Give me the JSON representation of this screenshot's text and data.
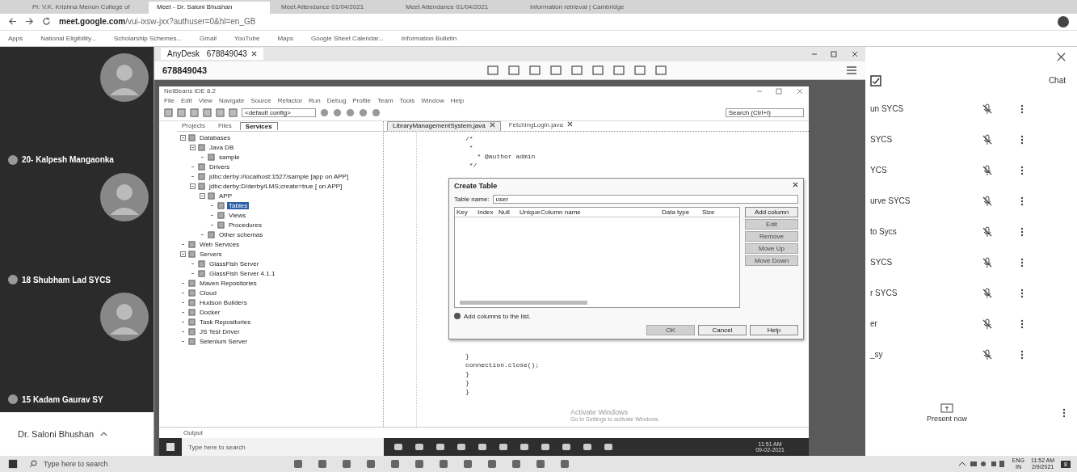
{
  "browser": {
    "tabs": [
      {
        "label": "Pr. V.K. Krishna Menon College of",
        "selected": false
      },
      {
        "label": "Meet - Dr. Saloni Bhushan",
        "selected": true
      },
      {
        "label": "Meet Attendance 01/04/2021",
        "selected": false
      },
      {
        "label": "Meet Attendance 01/04/2021",
        "selected": false
      },
      {
        "label": "Information retrieval | Cambridge",
        "selected": false
      }
    ],
    "address_host": "meet.google.com",
    "address_path": "/vui-ixsw-jxx?authuser=0&hl=en_GB",
    "bookmarks": [
      "Apps",
      "National Eligibility...",
      "Scholarship Schemes...",
      "Gmail",
      "YouTube",
      "Maps",
      "Google Sheet Calendar...",
      "Information Bulletin"
    ]
  },
  "meet": {
    "tiles": [
      {
        "name": "20- Kalpesh Mangaonka"
      },
      {
        "name": "18 Shubham Lad SYCS"
      },
      {
        "name": "15 Kadam Gaurav SY"
      }
    ],
    "presenter": "Dr. Saloni Bhushan",
    "chat": "Chat",
    "people": [
      {
        "name": "un SYCS",
        "muted": true
      },
      {
        "name": "SYCS",
        "muted": true
      },
      {
        "name": "YCS",
        "muted": true
      },
      {
        "name": "urve SYCS",
        "muted": true
      },
      {
        "name": "to Sycs",
        "muted": true
      },
      {
        "name": "SYCS",
        "muted": true
      },
      {
        "name": "r SYCS",
        "muted": true
      },
      {
        "name": "er",
        "muted": true
      },
      {
        "name": "_sy",
        "muted": true
      }
    ],
    "present": "Present now"
  },
  "anydesk": {
    "tab": "AnyDesk",
    "tab_id": "678849043",
    "address": "678849043"
  },
  "netbeans": {
    "title": "NetBeans IDE 8.2",
    "menu": [
      "File",
      "Edit",
      "View",
      "Navigate",
      "Source",
      "Refactor",
      "Run",
      "Debug",
      "Profile",
      "Team",
      "Tools",
      "Window",
      "Help"
    ],
    "config": "<default config>",
    "search": "Search (Ctrl+I)",
    "panel_tabs": [
      {
        "label": "Projects",
        "selected": false
      },
      {
        "label": "Files",
        "selected": false
      },
      {
        "label": "Services",
        "selected": true
      }
    ],
    "tree": [
      {
        "label": "Databases",
        "selected": false,
        "children": [
          {
            "label": "Java DB",
            "selected": false,
            "children": [
              {
                "label": "sample",
                "selected": false
              }
            ]
          },
          {
            "label": "Drivers",
            "selected": false
          },
          {
            "label": "jdbc:derby://localhost:1527/sample [app on APP]",
            "selected": false
          },
          {
            "label": "jdbc:derby:D/derby/LMS;create=true [ on APP]",
            "selected": false,
            "children": [
              {
                "label": "APP",
                "selected": false,
                "children": [
                  {
                    "label": "Tables",
                    "selected": true
                  },
                  {
                    "label": "Views",
                    "selected": false
                  },
                  {
                    "label": "Procedures",
                    "selected": false
                  }
                ]
              },
              {
                "label": "Other schemas",
                "selected": false
              }
            ]
          }
        ]
      },
      {
        "label": "Web Services",
        "selected": false
      },
      {
        "label": "Servers",
        "selected": false,
        "children": [
          {
            "label": "GlassFish Server",
            "selected": false
          },
          {
            "label": "GlassFish Server 4.1.1",
            "selected": false
          }
        ]
      },
      {
        "label": "Maven Repositories",
        "selected": false
      },
      {
        "label": "Cloud",
        "selected": false
      },
      {
        "label": "Hudson Builders",
        "selected": false
      },
      {
        "label": "Docker",
        "selected": false
      },
      {
        "label": "Task Repositories",
        "selected": false
      },
      {
        "label": "JS Test Driver",
        "selected": false
      },
      {
        "label": "Selenium Server",
        "selected": false
      }
    ],
    "editor_tabs": [
      {
        "label": "LibraryManagementSystem.java",
        "selected": true
      },
      {
        "label": "FetchingLogin.java",
        "selected": false
      }
    ],
    "code_top": [
      "/*",
      " *",
      "   * @author admin",
      " */"
    ],
    "code_bottom": [
      "}",
      "connection.close();",
      "}",
      "}",
      "}"
    ],
    "output": "Output",
    "watermark": [
      "Activate Windows",
      "Go to Settings to activate Windows."
    ]
  },
  "dialog": {
    "title": "Create Table",
    "name_label": "Table name:",
    "table_name": "user",
    "columns": [
      "Key",
      "Index",
      "Null",
      "Unique",
      "Column name",
      "Data type",
      "Size"
    ],
    "side_buttons": [
      {
        "label": "Add column",
        "disabled": false
      },
      {
        "label": "Edit",
        "disabled": true
      },
      {
        "label": "Remove",
        "disabled": true
      },
      {
        "label": "Move Up",
        "disabled": true
      },
      {
        "label": "Move Down",
        "disabled": true
      }
    ],
    "hint": "Add columns to the list.",
    "footer_buttons": [
      {
        "label": "OK",
        "disabled": true
      },
      {
        "label": "Cancel",
        "disabled": false
      },
      {
        "label": "Help",
        "disabled": false
      }
    ]
  },
  "remote_taskbar": {
    "search": "Type here to search",
    "time": "11:51 AM",
    "date": "09-02-2021"
  },
  "taskbar": {
    "search": "Type here to search",
    "lang": "ENG",
    "region": "IN",
    "time": "11:52 AM",
    "date": "2/9/2021",
    "notifications": "8"
  }
}
